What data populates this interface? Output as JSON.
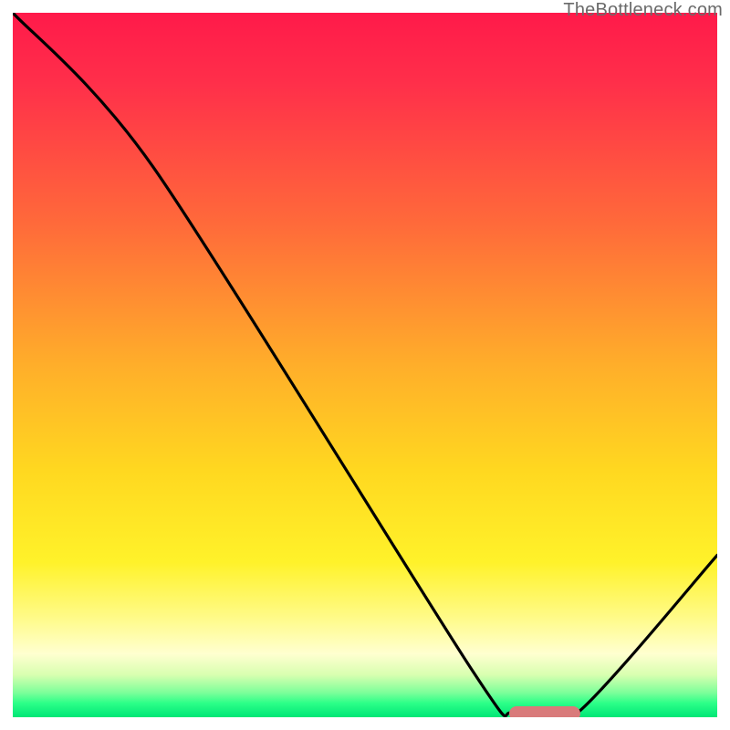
{
  "watermark": "TheBottleneck.com",
  "chart_data": {
    "type": "line",
    "title": "",
    "xlabel": "",
    "ylabel": "",
    "xlim": [
      0,
      100
    ],
    "ylim": [
      0,
      100
    ],
    "grid": false,
    "series": [
      {
        "name": "curve",
        "x": [
          0,
          20,
          65,
          71,
          80,
          100
        ],
        "values": [
          100,
          78,
          7,
          0.5,
          0.5,
          23
        ]
      }
    ],
    "marker": {
      "x_start": 71,
      "x_end": 80,
      "y": 0.5
    },
    "colors": {
      "curve": "#000000",
      "marker": "#d97a7a",
      "gradient_top": "#ff1a4a",
      "gradient_bottom": "#00e676"
    }
  }
}
